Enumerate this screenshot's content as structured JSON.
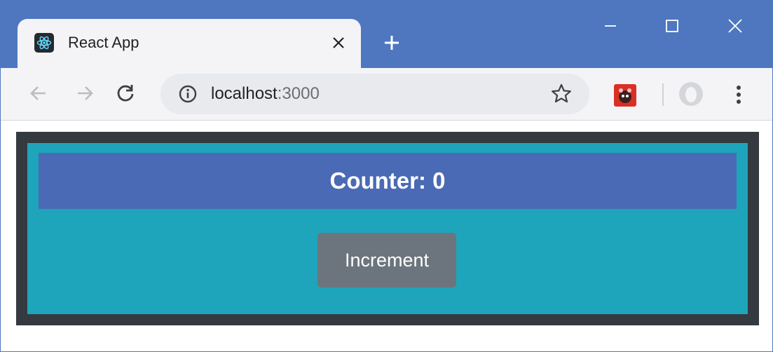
{
  "browser": {
    "tab": {
      "title": "React App",
      "favicon": "react-logo-icon",
      "close_glyph": "✕"
    },
    "newtab_icon": "plus-icon",
    "window_controls": [
      "minimize-icon",
      "maximize-icon",
      "close-icon"
    ],
    "address": {
      "host": "localhost",
      "port": ":3000",
      "info_icon": "info-icon"
    },
    "toolbar_icons": [
      "back-arrow-icon",
      "forward-arrow-icon",
      "reload-icon",
      "star-icon",
      "extension-icon",
      "profile-avatar-icon",
      "kebab-menu-icon"
    ]
  },
  "app": {
    "counter_label": "Counter: 0",
    "increment_label": "Increment"
  },
  "colors": {
    "titlebar": "#4e77c0",
    "outer_border": "#343a40",
    "panel": "#1ea5bb",
    "header": "#4b6ab5",
    "button": "#6c757d"
  }
}
